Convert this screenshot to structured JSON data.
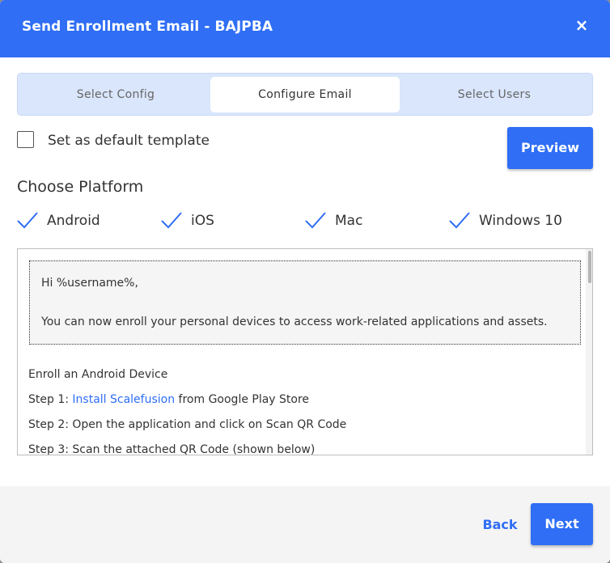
{
  "dialog": {
    "title": "Send Enrollment Email - BAJPBA",
    "close_glyph": "×"
  },
  "tabs": [
    {
      "label": "Select Config",
      "active": false
    },
    {
      "label": "Configure Email",
      "active": true
    },
    {
      "label": "Select Users",
      "active": false
    }
  ],
  "default_template": {
    "label": "Set as default template",
    "checked": false
  },
  "preview_label": "Preview",
  "platform": {
    "title": "Choose Platform",
    "items": [
      {
        "label": "Android",
        "checked": true
      },
      {
        "label": "iOS",
        "checked": true
      },
      {
        "label": "Mac",
        "checked": true
      },
      {
        "label": "Windows 10",
        "checked": true
      }
    ]
  },
  "email": {
    "greeting": "Hi %username%,",
    "intro": "You can now enroll your personal devices to access work-related applications and assets.",
    "section_title": "Enroll an Android Device",
    "step1_prefix": "Step 1: ",
    "step1_link": "Install Scalefusion",
    "step1_suffix": " from Google Play Store",
    "step2": "Step 2: Open the application and click on Scan QR Code",
    "step3": "Step 3: Scan the attached QR Code (shown below)"
  },
  "footer": {
    "back_label": "Back",
    "next_label": "Next"
  },
  "colors": {
    "accent": "#2f6ef5",
    "tab_bg": "#d9e6fc"
  }
}
